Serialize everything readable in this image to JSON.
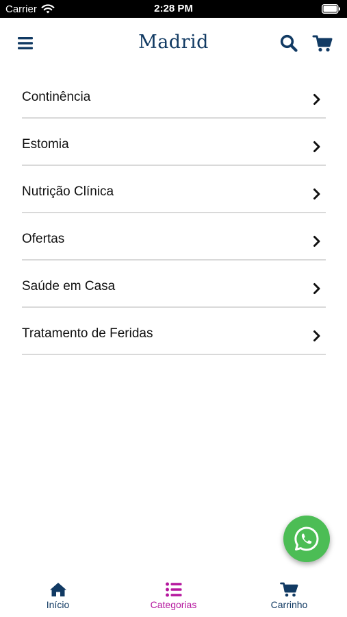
{
  "status_bar": {
    "carrier": "Carrier",
    "time": "2:28 PM"
  },
  "header": {
    "brand": "Madrid",
    "menu_icon": "hamburger-icon",
    "search_icon": "search-icon",
    "cart_icon": "cart-icon"
  },
  "categories": [
    {
      "label": "Continência"
    },
    {
      "label": "Estomia"
    },
    {
      "label": "Nutrição Clínica"
    },
    {
      "label": "Ofertas"
    },
    {
      "label": "Saúde em Casa"
    },
    {
      "label": "Tratamento de Feridas"
    }
  ],
  "whatsapp": {
    "icon": "whatsapp-icon"
  },
  "tab_bar": {
    "tabs": [
      {
        "label": "Início",
        "icon": "home-icon",
        "active": false
      },
      {
        "label": "Categorias",
        "icon": "list-icon",
        "active": true
      },
      {
        "label": "Carrinho",
        "icon": "cart-icon",
        "active": false
      }
    ]
  },
  "colors": {
    "primary": "#113a63",
    "active_tab": "#b5179e",
    "whatsapp": "#4cbd55",
    "divider": "#d9d9d9"
  }
}
